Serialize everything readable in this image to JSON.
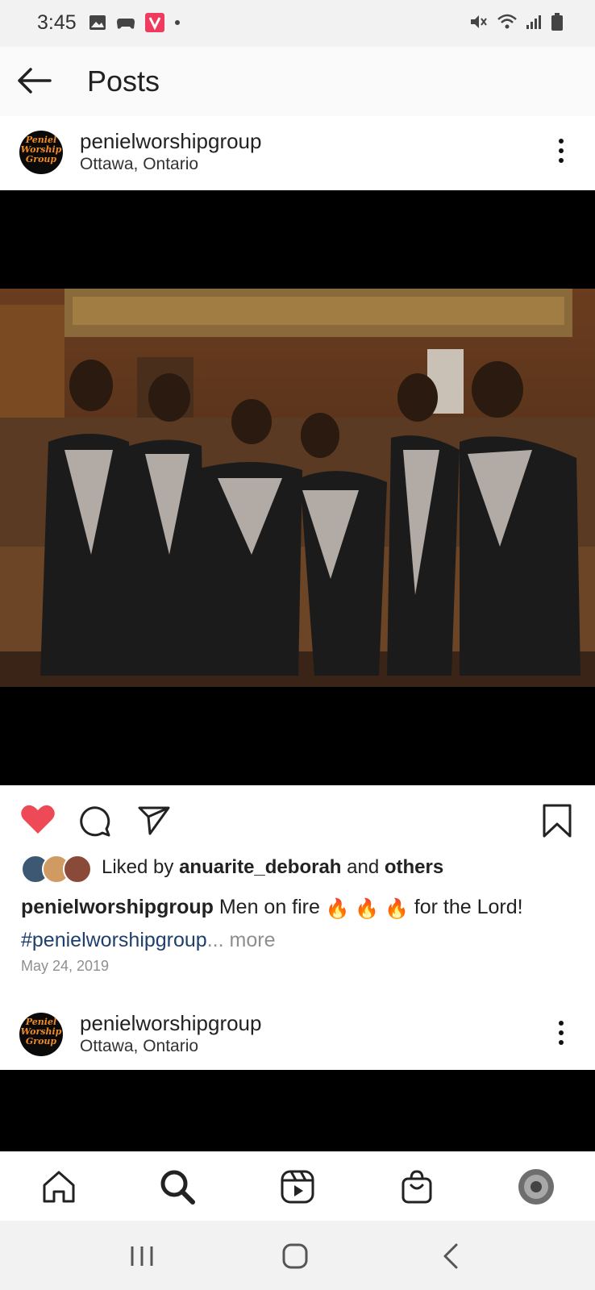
{
  "status_bar": {
    "time": "3:45",
    "left_icons": [
      "gallery-icon",
      "game-controller-icon",
      "v-app-icon",
      "dot-icon"
    ],
    "right_icons": [
      "mute-icon",
      "wifi-icon",
      "signal-icon",
      "battery-icon"
    ]
  },
  "app_bar": {
    "title": "Posts"
  },
  "post": {
    "username": "penielworshipgroup",
    "location": "Ottawa, Ontario",
    "avatar_logo_text": "Peniel Worship Group",
    "liked_by_prefix": "Liked by ",
    "liked_by_user": "anuarite_deborah",
    "liked_by_and": " and ",
    "liked_by_others": "others",
    "caption_username": "penielworshipgroup",
    "caption_text_1": " Men on fire ",
    "caption_emojis": "🔥 🔥 🔥",
    "caption_text_2": " for the Lord!",
    "caption_hashtag": "#penielworshipgroup",
    "caption_ellipsis": "...",
    "caption_more": " more",
    "date": "May 24, 2019",
    "liked": true
  },
  "next_post": {
    "username": "penielworshipgroup",
    "location": "Ottawa, Ontario"
  },
  "colors": {
    "heart": "#ed4956",
    "hashtag": "#1e3f6e",
    "muted": "#8e8e8e",
    "logo_orange": "#f08a24"
  },
  "bottom_nav": [
    "home-icon",
    "search-icon",
    "reels-icon",
    "shop-icon",
    "profile-avatar"
  ],
  "system_nav": [
    "recent-apps-icon",
    "home-button-icon",
    "back-nav-icon"
  ]
}
